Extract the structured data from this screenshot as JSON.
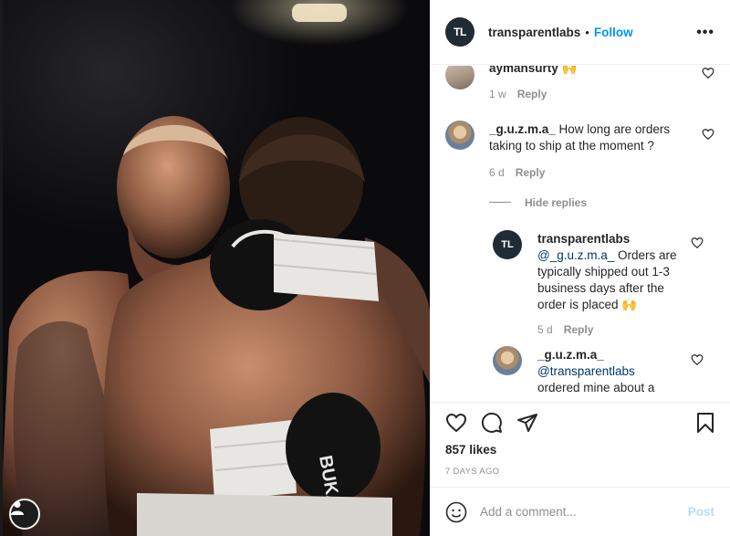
{
  "post": {
    "author": "transparentlabs",
    "logo_text": "TL",
    "separator": "•",
    "follow_label": "Follow",
    "more_label": "•••",
    "photo_glove_text": "BUKA"
  },
  "comments": [
    {
      "username": "aymansurty",
      "text": "🙌",
      "age": "1 w",
      "reply_label": "Reply"
    },
    {
      "username": "_g.u.z.m.a_",
      "text_line1": "How long are orders",
      "text_line2": "taking to ship at the moment ?",
      "age": "6 d",
      "reply_label": "Reply",
      "hide_replies_label": "Hide replies",
      "replies": [
        {
          "username": "transparentlabs",
          "avatar_text": "TL",
          "mention": "@_g.u.z.m.a_",
          "text_l1": "Orders are",
          "text_l2": "typically shipped out 1-3",
          "text_l3": "business days after the",
          "text_l4": "order is placed 🙌",
          "age": "5 d",
          "reply_label": "Reply"
        },
        {
          "username": "_g.u.z.m.a_",
          "mention": "@transparentlabs",
          "text_l1": "ordered mine about a"
        }
      ]
    }
  ],
  "likes": "857 likes",
  "date": "7 DAYS AGO",
  "composer": {
    "placeholder": "Add a comment...",
    "post_label": "Post"
  },
  "colors": {
    "accent": "#0095f6",
    "mention": "#00376b",
    "muted": "#8e8e8e",
    "post_disabled": "#b2dffc",
    "brand_dark": "#1f2c35"
  }
}
